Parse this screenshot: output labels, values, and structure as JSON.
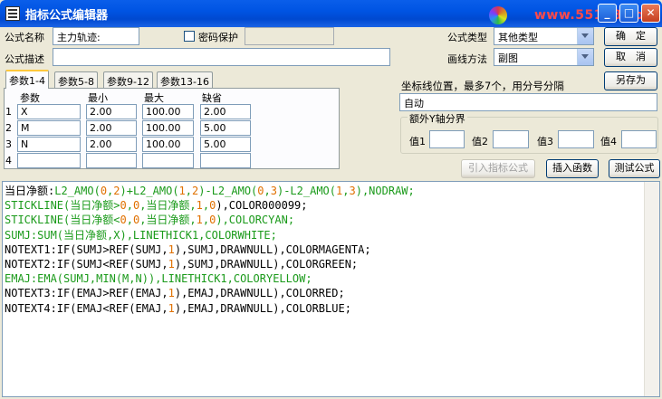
{
  "window": {
    "title": "指标公式编辑器",
    "watermark": "www.55188.com"
  },
  "form": {
    "name_label": "公式名称",
    "name_value": "主力轨迹:",
    "password_label": "密码保护",
    "desc_label": "公式描述",
    "desc_value": "",
    "type_label": "公式类型",
    "type_value": "其他类型",
    "draw_label": "画线方法",
    "draw_value": "副图",
    "ok_button": "确　定",
    "cancel_button": "取　消",
    "saveas_button": "另存为",
    "coord_label": "坐标线位置，最多7个，用分号分隔",
    "coord_value": "自动",
    "yaxis_group": "额外Y轴分界",
    "yaxis_values": [
      {
        "label": "值1",
        "value": ""
      },
      {
        "label": "值2",
        "value": ""
      },
      {
        "label": "值3",
        "value": ""
      },
      {
        "label": "值4",
        "value": ""
      }
    ],
    "import_button": "引入指标公式",
    "insert_button": "插入函数",
    "test_button": "测试公式"
  },
  "params": {
    "tabs": [
      "参数1-4",
      "参数5-8",
      "参数9-12",
      "参数13-16"
    ],
    "headers": [
      "参数",
      "最小",
      "最大",
      "缺省"
    ],
    "rows": [
      {
        "num": "1",
        "name": "X",
        "min": "2.00",
        "max": "100.00",
        "def": "2.00"
      },
      {
        "num": "2",
        "name": "M",
        "min": "2.00",
        "max": "100.00",
        "def": "5.00"
      },
      {
        "num": "3",
        "name": "N",
        "min": "2.00",
        "max": "100.00",
        "def": "5.00"
      },
      {
        "num": "4",
        "name": "",
        "min": "",
        "max": "",
        "def": ""
      }
    ]
  },
  "code_lines": [
    [
      [
        "当日净额:",
        "k"
      ],
      [
        "L2_AMO(",
        "g"
      ],
      [
        "0",
        "o"
      ],
      [
        ",",
        "g"
      ],
      [
        "2",
        "o"
      ],
      [
        ")+L2_AMO(",
        "g"
      ],
      [
        "1",
        "o"
      ],
      [
        ",",
        "g"
      ],
      [
        "2",
        "o"
      ],
      [
        ")-L2_AMO(",
        "g"
      ],
      [
        "0",
        "o"
      ],
      [
        ",",
        "g"
      ],
      [
        "3",
        "o"
      ],
      [
        ")-L2_AMO(",
        "g"
      ],
      [
        "1",
        "o"
      ],
      [
        ",",
        "g"
      ],
      [
        "3",
        "o"
      ],
      [
        "),NODRAW;",
        "g"
      ]
    ],
    [
      [
        "STICKLINE(当日净额>",
        "g"
      ],
      [
        "0",
        "o"
      ],
      [
        ",",
        "g"
      ],
      [
        "0",
        "o"
      ],
      [
        ",当日净额,",
        "g"
      ],
      [
        "1",
        "o"
      ],
      [
        ",",
        "g"
      ],
      [
        "0",
        "o"
      ],
      [
        "),COLOR000099;",
        "k"
      ]
    ],
    [
      [
        "STICKLINE(当日净额<",
        "g"
      ],
      [
        "0",
        "o"
      ],
      [
        ",",
        "g"
      ],
      [
        "0",
        "o"
      ],
      [
        ",当日净额,",
        "g"
      ],
      [
        "1",
        "o"
      ],
      [
        ",",
        "g"
      ],
      [
        "0",
        "o"
      ],
      [
        "),COLORCYAN;",
        "g"
      ]
    ],
    [
      [
        "SUMJ:SUM(当日净额,X),LINETHICK1,COLORWHITE;",
        "g"
      ]
    ],
    [
      [
        "NOTEXT1:IF(SUMJ>REF(SUMJ,",
        "k"
      ],
      [
        "1",
        "o"
      ],
      [
        "),SUMJ,DRAWNULL),COLORMAGENTA;",
        "k"
      ]
    ],
    [
      [
        "NOTEXT2:IF(SUMJ<REF(SUMJ,",
        "k"
      ],
      [
        "1",
        "o"
      ],
      [
        "),SUMJ,DRAWNULL),COLORGREEN;",
        "k"
      ]
    ],
    [
      [
        "EMAJ:EMA(SUMJ,MIN(M,N)),LINETHICK1,COLORYELLOW;",
        "g"
      ]
    ],
    [
      [
        "NOTEXT3:IF(EMAJ>REF(EMAJ,",
        "k"
      ],
      [
        "1",
        "o"
      ],
      [
        "),EMAJ,DRAWNULL),COLORRED;",
        "k"
      ]
    ],
    [
      [
        "NOTEXT4:IF(EMAJ<REF(EMAJ,",
        "k"
      ],
      [
        "1",
        "o"
      ],
      [
        "),EMAJ,DRAWNULL),COLORBLUE;",
        "k"
      ]
    ]
  ]
}
